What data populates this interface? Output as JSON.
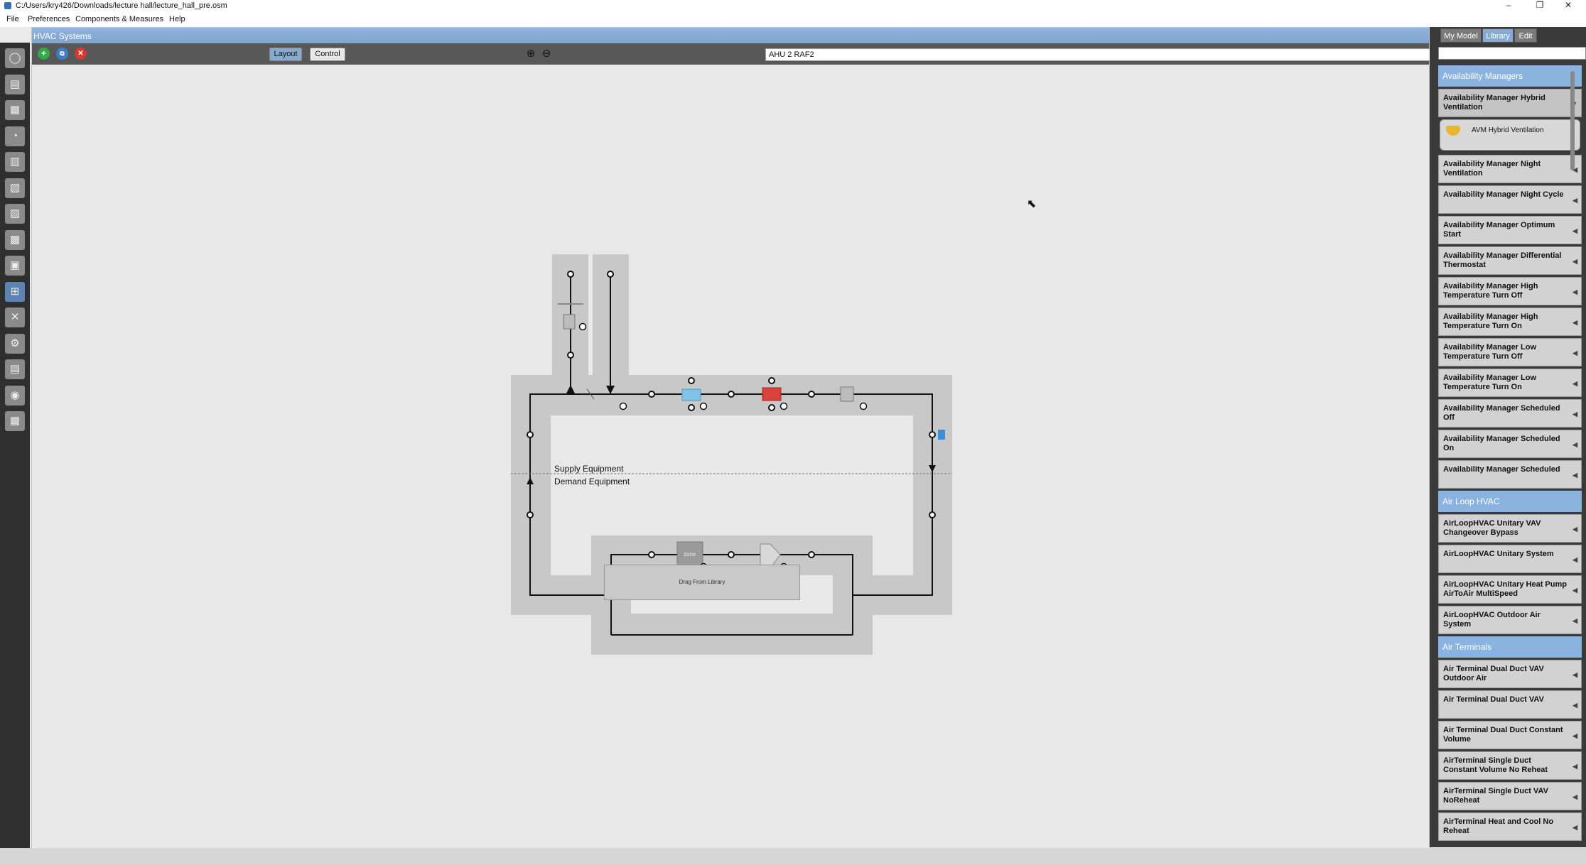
{
  "window": {
    "title": "C:/Users/kry426/Downloads/lecture hall/lecture_hall_pre.osm",
    "minimize": "–",
    "maximize": "❐",
    "close": "✕"
  },
  "menu": [
    "File",
    "Preferences",
    "Components & Measures",
    "Help"
  ],
  "left_toolbar": {
    "icons": [
      "site-icon",
      "schedules-icon",
      "constructions-icon",
      "loads-icon",
      "space-types-icon",
      "geometry-icon",
      "facility-icon",
      "spaces-icon",
      "thermal-zones-icon",
      "hvac-systems-icon",
      "output-variables-icon",
      "simulation-settings-icon",
      "measures-icon",
      "run-simulation-icon",
      "results-icon"
    ],
    "active_index": 9
  },
  "hvac": {
    "header": "HVAC Systems",
    "toolbar": {
      "add": "+",
      "copy": "⧉",
      "delete": "✕",
      "layout": "Layout",
      "control": "Control",
      "zoom_in": "⊕",
      "zoom_out": "⊖"
    },
    "loop_selector": {
      "value": "AHU 2 RAF2",
      "arrows": "▴▾"
    },
    "diagram": {
      "supply_label": "Supply Equipment",
      "demand_label": "Demand Equipment",
      "zone_label": "zone",
      "drag_label": "Drag From Library"
    }
  },
  "right_panel": {
    "tabs": [
      "My Model",
      "Library",
      "Edit"
    ],
    "active_tab": "Library",
    "sections": [
      {
        "category": "Availability Managers",
        "items": [
          {
            "label": "Availability Manager Hybrid Ventilation",
            "expanded": true,
            "children": [
              "AVM Hybrid Ventilation"
            ]
          },
          {
            "label": "Availability Manager Night Ventilation"
          },
          {
            "label": "Availability Manager Night Cycle"
          },
          {
            "label": "Availability Manager Optimum Start"
          },
          {
            "label": "Availability Manager Differential Thermostat"
          },
          {
            "label": "Availability Manager High Temperature Turn Off"
          },
          {
            "label": "Availability Manager High Temperature Turn On"
          },
          {
            "label": "Availability Manager Low Temperature Turn Off"
          },
          {
            "label": "Availability Manager Low Temperature Turn On"
          },
          {
            "label": "Availability Manager Scheduled Off"
          },
          {
            "label": "Availability Manager Scheduled On"
          },
          {
            "label": "Availability Manager Scheduled"
          }
        ]
      },
      {
        "category": "Air Loop HVAC",
        "items": [
          {
            "label": "AirLoopHVAC Unitary VAV Changeover Bypass"
          },
          {
            "label": "AirLoopHVAC Unitary System"
          },
          {
            "label": "AirLoopHVAC Unitary Heat Pump AirToAir MultiSpeed"
          },
          {
            "label": "AirLoopHVAC Outdoor Air System"
          }
        ]
      },
      {
        "category": "Air Terminals",
        "items": [
          {
            "label": "Air Terminal Dual Duct VAV Outdoor Air"
          },
          {
            "label": "Air Terminal Dual Duct VAV"
          },
          {
            "label": "Air Terminal Dual Duct Constant Volume"
          },
          {
            "label": "AirTerminal Single Duct Constant Volume No Reheat"
          },
          {
            "label": "AirTerminal Single Duct VAV NoReheat"
          },
          {
            "label": "AirTerminal Heat and Cool No Reheat"
          }
        ]
      }
    ]
  },
  "colors": {
    "accent": "#87aad4",
    "cooling_coil": "#7fc4e6",
    "heating_coil": "#d9423a",
    "setpoint": "#3a8fd8"
  }
}
